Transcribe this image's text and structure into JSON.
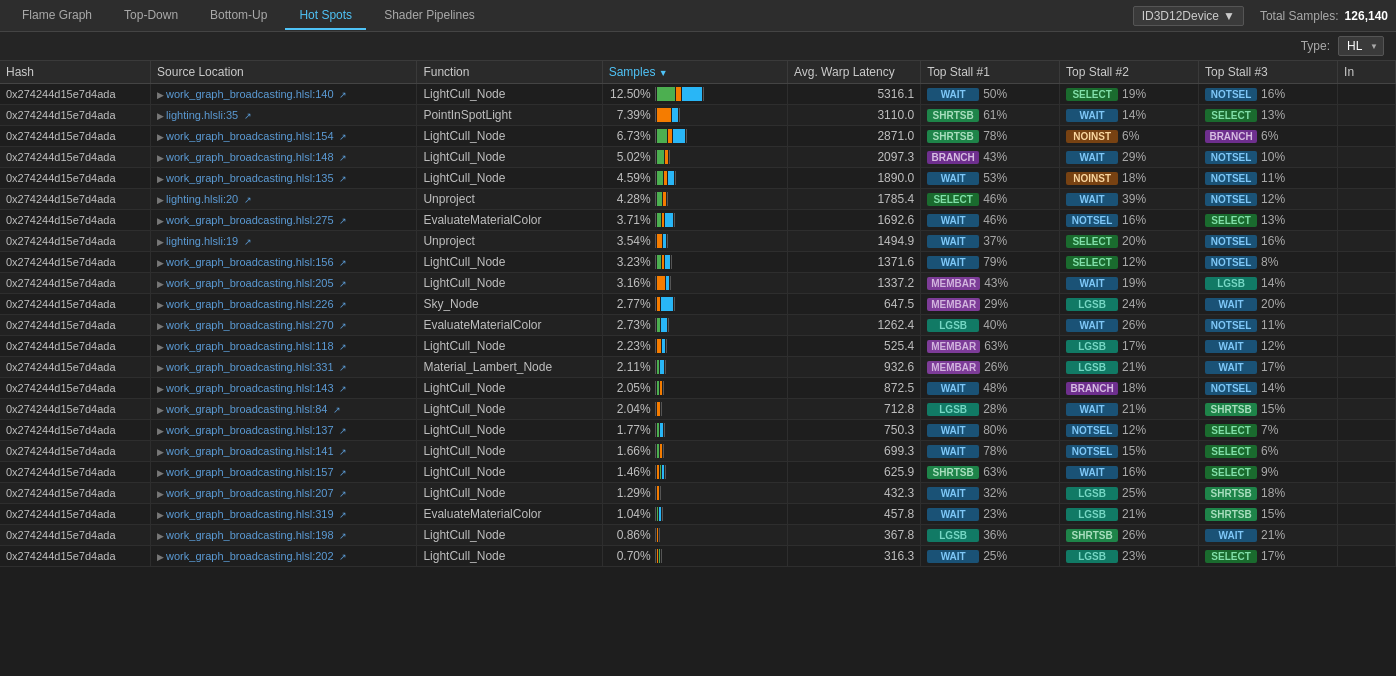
{
  "nav": {
    "tabs": [
      {
        "label": "Flame Graph",
        "active": false
      },
      {
        "label": "Top-Down",
        "active": false
      },
      {
        "label": "Bottom-Up",
        "active": false
      },
      {
        "label": "Hot Spots",
        "active": true
      },
      {
        "label": "Shader Pipelines",
        "active": false
      }
    ],
    "device": "ID3D12Device",
    "total_samples_label": "Total Samples:",
    "total_samples_value": "126,140",
    "type_label": "Type:",
    "type_value": "HL"
  },
  "table": {
    "columns": [
      {
        "key": "hash",
        "label": "Hash"
      },
      {
        "key": "source",
        "label": "Source Location"
      },
      {
        "key": "function",
        "label": "Function"
      },
      {
        "key": "samples",
        "label": "Samples",
        "sorted": true
      },
      {
        "key": "avgwarp",
        "label": "Avg. Warp Latency"
      },
      {
        "key": "stall1",
        "label": "Top Stall #1"
      },
      {
        "key": "stall2",
        "label": "Top Stall #2"
      },
      {
        "key": "stall3",
        "label": "Top Stall #3"
      },
      {
        "key": "in",
        "label": "In"
      }
    ],
    "rows": [
      {
        "hash": "0x274244d15e7d4ada",
        "source": "work_graph_broadcasting.hlsl:140",
        "function": "LightCull_Node",
        "samples_pct": "12.50%",
        "bar": [
          {
            "color": "#4caf50",
            "w": 18
          },
          {
            "color": "#f57c00",
            "w": 5
          },
          {
            "color": "#29b6f6",
            "w": 20
          }
        ],
        "avgwarp": "5316.1",
        "stall1_badge": "WAIT",
        "stall1_type": "wait",
        "stall1_pct": "50%",
        "stall2_badge": "SELECT",
        "stall2_type": "select",
        "stall2_pct": "19%",
        "stall3_badge": "NOTSEL",
        "stall3_type": "notsel",
        "stall3_pct": "16%",
        "in": ""
      },
      {
        "hash": "0x274244d15e7d4ada",
        "source": "lighting.hlsli:35",
        "function": "PointInSpotLight",
        "samples_pct": "7.39%",
        "bar": [
          {
            "color": "#f57c00",
            "w": 14
          },
          {
            "color": "#29b6f6",
            "w": 6
          }
        ],
        "avgwarp": "3110.0",
        "stall1_badge": "SHRTSB",
        "stall1_type": "shrtsb",
        "stall1_pct": "61%",
        "stall2_badge": "WAIT",
        "stall2_type": "wait",
        "stall2_pct": "14%",
        "stall3_badge": "SELECT",
        "stall3_type": "select",
        "stall3_pct": "13%",
        "in": ""
      },
      {
        "hash": "0x274244d15e7d4ada",
        "source": "work_graph_broadcasting.hlsl:154",
        "function": "LightCull_Node",
        "samples_pct": "6.73%",
        "bar": [
          {
            "color": "#4caf50",
            "w": 10
          },
          {
            "color": "#f57c00",
            "w": 4
          },
          {
            "color": "#29b6f6",
            "w": 12
          }
        ],
        "avgwarp": "2871.0",
        "stall1_badge": "SHRTSB",
        "stall1_type": "shrtsb",
        "stall1_pct": "78%",
        "stall2_badge": "NOINST",
        "stall2_type": "noinst",
        "stall2_pct": "6%",
        "stall3_badge": "BRANCH",
        "stall3_type": "branch",
        "stall3_pct": "6%",
        "in": ""
      },
      {
        "hash": "0x274244d15e7d4ada",
        "source": "work_graph_broadcasting.hlsl:148",
        "function": "LightCull_Node",
        "samples_pct": "5.02%",
        "bar": [
          {
            "color": "#4caf50",
            "w": 7
          },
          {
            "color": "#f57c00",
            "w": 3
          }
        ],
        "avgwarp": "2097.3",
        "stall1_badge": "BRANCH",
        "stall1_type": "branch",
        "stall1_pct": "43%",
        "stall2_badge": "WAIT",
        "stall2_type": "wait",
        "stall2_pct": "29%",
        "stall3_badge": "NOTSEL",
        "stall3_type": "notsel",
        "stall3_pct": "10%",
        "in": ""
      },
      {
        "hash": "0x274244d15e7d4ada",
        "source": "work_graph_broadcasting.hlsl:135",
        "function": "LightCull_Node",
        "samples_pct": "4.59%",
        "bar": [
          {
            "color": "#4caf50",
            "w": 6
          },
          {
            "color": "#f57c00",
            "w": 3
          },
          {
            "color": "#29b6f6",
            "w": 6
          }
        ],
        "avgwarp": "1890.0",
        "stall1_badge": "WAIT",
        "stall1_type": "wait",
        "stall1_pct": "53%",
        "stall2_badge": "NOINST",
        "stall2_type": "noinst",
        "stall2_pct": "18%",
        "stall3_badge": "NOTSEL",
        "stall3_type": "notsel",
        "stall3_pct": "11%",
        "in": ""
      },
      {
        "hash": "0x274244d15e7d4ada",
        "source": "lighting.hlsli:20",
        "function": "Unproject",
        "samples_pct": "4.28%",
        "bar": [
          {
            "color": "#4caf50",
            "w": 5
          },
          {
            "color": "#f57c00",
            "w": 3
          }
        ],
        "avgwarp": "1785.4",
        "stall1_badge": "SELECT",
        "stall1_type": "select",
        "stall1_pct": "46%",
        "stall2_badge": "WAIT",
        "stall2_type": "wait",
        "stall2_pct": "39%",
        "stall3_badge": "NOTSEL",
        "stall3_type": "notsel",
        "stall3_pct": "12%",
        "in": ""
      },
      {
        "hash": "0x274244d15e7d4ada",
        "source": "work_graph_broadcasting.hlsl:275",
        "function": "EvaluateMaterialColor",
        "samples_pct": "3.71%",
        "bar": [
          {
            "color": "#4caf50",
            "w": 4
          },
          {
            "color": "#f57c00",
            "w": 2
          },
          {
            "color": "#29b6f6",
            "w": 8
          }
        ],
        "avgwarp": "1692.6",
        "stall1_badge": "WAIT",
        "stall1_type": "wait",
        "stall1_pct": "46%",
        "stall2_badge": "NOTSEL",
        "stall2_type": "notsel",
        "stall2_pct": "16%",
        "stall3_badge": "SELECT",
        "stall3_type": "select",
        "stall3_pct": "13%",
        "in": ""
      },
      {
        "hash": "0x274244d15e7d4ada",
        "source": "lighting.hlsli:19",
        "function": "Unproject",
        "samples_pct": "3.54%",
        "bar": [
          {
            "color": "#f57c00",
            "w": 5
          },
          {
            "color": "#29b6f6",
            "w": 3
          }
        ],
        "avgwarp": "1494.9",
        "stall1_badge": "WAIT",
        "stall1_type": "wait",
        "stall1_pct": "37%",
        "stall2_badge": "SELECT",
        "stall2_type": "select",
        "stall2_pct": "20%",
        "stall3_badge": "NOTSEL",
        "stall3_type": "notsel",
        "stall3_pct": "16%",
        "in": ""
      },
      {
        "hash": "0x274244d15e7d4ada",
        "source": "work_graph_broadcasting.hlsl:156",
        "function": "LightCull_Node",
        "samples_pct": "3.23%",
        "bar": [
          {
            "color": "#4caf50",
            "w": 4
          },
          {
            "color": "#f57c00",
            "w": 2
          },
          {
            "color": "#29b6f6",
            "w": 5
          }
        ],
        "avgwarp": "1371.6",
        "stall1_badge": "WAIT",
        "stall1_type": "wait",
        "stall1_pct": "79%",
        "stall2_badge": "SELECT",
        "stall2_type": "select",
        "stall2_pct": "12%",
        "stall3_badge": "NOTSEL",
        "stall3_type": "notsel",
        "stall3_pct": "8%",
        "in": ""
      },
      {
        "hash": "0x274244d15e7d4ada",
        "source": "work_graph_broadcasting.hlsl:205",
        "function": "LightCull_Node",
        "samples_pct": "3.16%",
        "bar": [
          {
            "color": "#f57c00",
            "w": 8
          },
          {
            "color": "#29b6f6",
            "w": 3
          }
        ],
        "avgwarp": "1337.2",
        "stall1_badge": "MEMBAR",
        "stall1_type": "membar",
        "stall1_pct": "43%",
        "stall2_badge": "WAIT",
        "stall2_type": "wait",
        "stall2_pct": "19%",
        "stall3_badge": "LGSB",
        "stall3_type": "lgsb",
        "stall3_pct": "14%",
        "in": ""
      },
      {
        "hash": "0x274244d15e7d4ada",
        "source": "work_graph_broadcasting.hlsl:226",
        "function": "Sky_Node",
        "samples_pct": "2.77%",
        "bar": [
          {
            "color": "#f57c00",
            "w": 3
          },
          {
            "color": "#29b6f6",
            "w": 12
          }
        ],
        "avgwarp": "647.5",
        "stall1_badge": "MEMBAR",
        "stall1_type": "membar",
        "stall1_pct": "29%",
        "stall2_badge": "LGSB",
        "stall2_type": "lgsb",
        "stall2_pct": "24%",
        "stall3_badge": "WAIT",
        "stall3_type": "wait",
        "stall3_pct": "20%",
        "in": ""
      },
      {
        "hash": "0x274244d15e7d4ada",
        "source": "work_graph_broadcasting.hlsl:270",
        "function": "EvaluateMaterialColor",
        "samples_pct": "2.73%",
        "bar": [
          {
            "color": "#4caf50",
            "w": 3
          },
          {
            "color": "#29b6f6",
            "w": 6
          }
        ],
        "avgwarp": "1262.4",
        "stall1_badge": "LGSB",
        "stall1_type": "lgsb",
        "stall1_pct": "40%",
        "stall2_badge": "WAIT",
        "stall2_type": "wait",
        "stall2_pct": "26%",
        "stall3_badge": "NOTSEL",
        "stall3_type": "notsel",
        "stall3_pct": "11%",
        "in": ""
      },
      {
        "hash": "0x274244d15e7d4ada",
        "source": "work_graph_broadcasting.hlsl:118",
        "function": "LightCull_Node",
        "samples_pct": "2.23%",
        "bar": [
          {
            "color": "#f57c00",
            "w": 4
          },
          {
            "color": "#29b6f6",
            "w": 3
          }
        ],
        "avgwarp": "525.4",
        "stall1_badge": "MEMBAR",
        "stall1_type": "membar",
        "stall1_pct": "63%",
        "stall2_badge": "LGSB",
        "stall2_type": "lgsb",
        "stall2_pct": "17%",
        "stall3_badge": "WAIT",
        "stall3_type": "wait",
        "stall3_pct": "12%",
        "in": ""
      },
      {
        "hash": "0x274244d15e7d4ada",
        "source": "work_graph_broadcasting.hlsl:331",
        "function": "Material_Lambert_Node",
        "samples_pct": "2.11%",
        "bar": [
          {
            "color": "#4caf50",
            "w": 2
          },
          {
            "color": "#29b6f6",
            "w": 4
          }
        ],
        "avgwarp": "932.6",
        "stall1_badge": "MEMBAR",
        "stall1_type": "membar",
        "stall1_pct": "26%",
        "stall2_badge": "LGSB",
        "stall2_type": "lgsb",
        "stall2_pct": "21%",
        "stall3_badge": "WAIT",
        "stall3_type": "wait",
        "stall3_pct": "17%",
        "in": ""
      },
      {
        "hash": "0x274244d15e7d4ada",
        "source": "work_graph_broadcasting.hlsl:143",
        "function": "LightCull_Node",
        "samples_pct": "2.05%",
        "bar": [
          {
            "color": "#4caf50",
            "w": 2
          },
          {
            "color": "#f57c00",
            "w": 2
          }
        ],
        "avgwarp": "872.5",
        "stall1_badge": "WAIT",
        "stall1_type": "wait",
        "stall1_pct": "48%",
        "stall2_badge": "BRANCH",
        "stall2_type": "branch",
        "stall2_pct": "18%",
        "stall3_badge": "NOTSEL",
        "stall3_type": "notsel",
        "stall3_pct": "14%",
        "in": ""
      },
      {
        "hash": "0x274244d15e7d4ada",
        "source": "work_graph_broadcasting.hlsl:84",
        "function": "LightCull_Node",
        "samples_pct": "2.04%",
        "bar": [
          {
            "color": "#f57c00",
            "w": 3
          }
        ],
        "avgwarp": "712.8",
        "stall1_badge": "LGSB",
        "stall1_type": "lgsb",
        "stall1_pct": "28%",
        "stall2_badge": "WAIT",
        "stall2_type": "wait",
        "stall2_pct": "21%",
        "stall3_badge": "SHRTSB",
        "stall3_type": "shrtsb",
        "stall3_pct": "15%",
        "in": ""
      },
      {
        "hash": "0x274244d15e7d4ada",
        "source": "work_graph_broadcasting.hlsl:137",
        "function": "LightCull_Node",
        "samples_pct": "1.77%",
        "bar": [
          {
            "color": "#4caf50",
            "w": 2
          },
          {
            "color": "#29b6f6",
            "w": 3
          }
        ],
        "avgwarp": "750.3",
        "stall1_badge": "WAIT",
        "stall1_type": "wait",
        "stall1_pct": "80%",
        "stall2_badge": "NOTSEL",
        "stall2_type": "notsel",
        "stall2_pct": "12%",
        "stall3_badge": "SELECT",
        "stall3_type": "select",
        "stall3_pct": "7%",
        "in": ""
      },
      {
        "hash": "0x274244d15e7d4ada",
        "source": "work_graph_broadcasting.hlsl:141",
        "function": "LightCull_Node",
        "samples_pct": "1.66%",
        "bar": [
          {
            "color": "#4caf50",
            "w": 2
          },
          {
            "color": "#f57c00",
            "w": 2
          }
        ],
        "avgwarp": "699.3",
        "stall1_badge": "WAIT",
        "stall1_type": "wait",
        "stall1_pct": "78%",
        "stall2_badge": "NOTSEL",
        "stall2_type": "notsel",
        "stall2_pct": "15%",
        "stall3_badge": "SELECT",
        "stall3_type": "select",
        "stall3_pct": "6%",
        "in": ""
      },
      {
        "hash": "0x274244d15e7d4ada",
        "source": "work_graph_broadcasting.hlsl:157",
        "function": "LightCull_Node",
        "samples_pct": "1.46%",
        "bar": [
          {
            "color": "#f57c00",
            "w": 2
          },
          {
            "color": "#4caf50",
            "w": 1
          },
          {
            "color": "#29b6f6",
            "w": 2
          }
        ],
        "avgwarp": "625.9",
        "stall1_badge": "SHRTSB",
        "stall1_type": "shrtsb",
        "stall1_pct": "63%",
        "stall2_badge": "WAIT",
        "stall2_type": "wait",
        "stall2_pct": "16%",
        "stall3_badge": "SELECT",
        "stall3_type": "select",
        "stall3_pct": "9%",
        "in": ""
      },
      {
        "hash": "0x274244d15e7d4ada",
        "source": "work_graph_broadcasting.hlsl:207",
        "function": "LightCull_Node",
        "samples_pct": "1.29%",
        "bar": [
          {
            "color": "#f57c00",
            "w": 2
          }
        ],
        "avgwarp": "432.3",
        "stall1_badge": "WAIT",
        "stall1_type": "wait",
        "stall1_pct": "32%",
        "stall2_badge": "LGSB",
        "stall2_type": "lgsb",
        "stall2_pct": "25%",
        "stall3_badge": "SHRTSB",
        "stall3_type": "shrtsb",
        "stall3_pct": "18%",
        "in": ""
      },
      {
        "hash": "0x274244d15e7d4ada",
        "source": "work_graph_broadcasting.hlsl:319",
        "function": "EvaluateMaterialColor",
        "samples_pct": "1.04%",
        "bar": [
          {
            "color": "#4caf50",
            "w": 1
          },
          {
            "color": "#29b6f6",
            "w": 2
          }
        ],
        "avgwarp": "457.8",
        "stall1_badge": "WAIT",
        "stall1_type": "wait",
        "stall1_pct": "23%",
        "stall2_badge": "LGSB",
        "stall2_type": "lgsb",
        "stall2_pct": "21%",
        "stall3_badge": "SHRTSB",
        "stall3_type": "shrtsb",
        "stall3_pct": "15%",
        "in": ""
      },
      {
        "hash": "0x274244d15e7d4ada",
        "source": "work_graph_broadcasting.hlsl:198",
        "function": "LightCull_Node",
        "samples_pct": "0.86%",
        "bar": [
          {
            "color": "#f57c00",
            "w": 1
          }
        ],
        "avgwarp": "367.8",
        "stall1_badge": "LGSB",
        "stall1_type": "lgsb",
        "stall1_pct": "36%",
        "stall2_badge": "SHRTSB",
        "stall2_type": "shrtsb",
        "stall2_pct": "26%",
        "stall3_badge": "WAIT",
        "stall3_type": "wait",
        "stall3_pct": "21%",
        "in": ""
      },
      {
        "hash": "0x274244d15e7d4ada",
        "source": "work_graph_broadcasting.hlsl:202",
        "function": "LightCull_Node",
        "samples_pct": "0.70%",
        "bar": [
          {
            "color": "#f57c00",
            "w": 1
          },
          {
            "color": "#4caf50",
            "w": 1
          }
        ],
        "avgwarp": "316.3",
        "stall1_badge": "WAIT",
        "stall1_type": "wait",
        "stall1_pct": "25%",
        "stall2_badge": "LGSB",
        "stall2_type": "lgsb",
        "stall2_pct": "23%",
        "stall3_badge": "SELECT",
        "stall3_type": "select",
        "stall3_pct": "17%",
        "in": ""
      }
    ]
  },
  "icons": {
    "chevron_down": "▼",
    "external_link": "↗",
    "sort_desc": "▼",
    "expand": "▶",
    "collapse": "▼"
  }
}
